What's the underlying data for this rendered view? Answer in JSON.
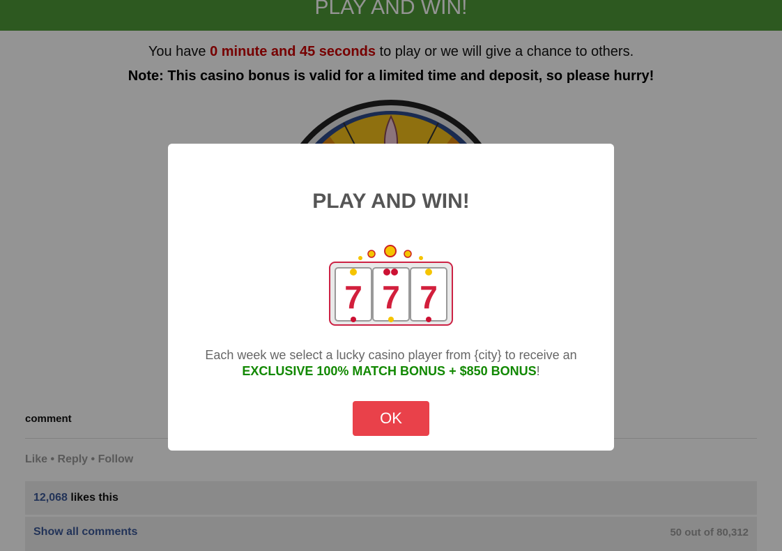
{
  "header": {
    "title": "PLAY AND WIN!"
  },
  "intro": {
    "prefix": "You have ",
    "timer": "0 minute and 45 seconds",
    "suffix": " to play or we will give a chance to others.",
    "note": "Note: This casino bonus is valid for a limited time and deposit, so please hurry!"
  },
  "comment_section": {
    "label": "comment",
    "actions": "Like • Reply • Follow",
    "likes_count": "12,068",
    "likes_suffix": " likes this",
    "show_all": "Show all comments",
    "count": "50 out of 80,312"
  },
  "modal": {
    "title": "PLAY AND WIN!",
    "text_line1": "Each week we select a lucky casino player from {city} to receive an",
    "bonus": "EXCLUSIVE 100% MATCH BONUS + $850 BONUS",
    "bonus_end": "!",
    "ok_label": "OK",
    "slot_symbols": [
      "7",
      "7",
      "7"
    ]
  },
  "colors": {
    "header_bg": "#4e9a37",
    "timer": "#cc0000",
    "bonus": "#118800",
    "ok_button": "#e9414a"
  }
}
